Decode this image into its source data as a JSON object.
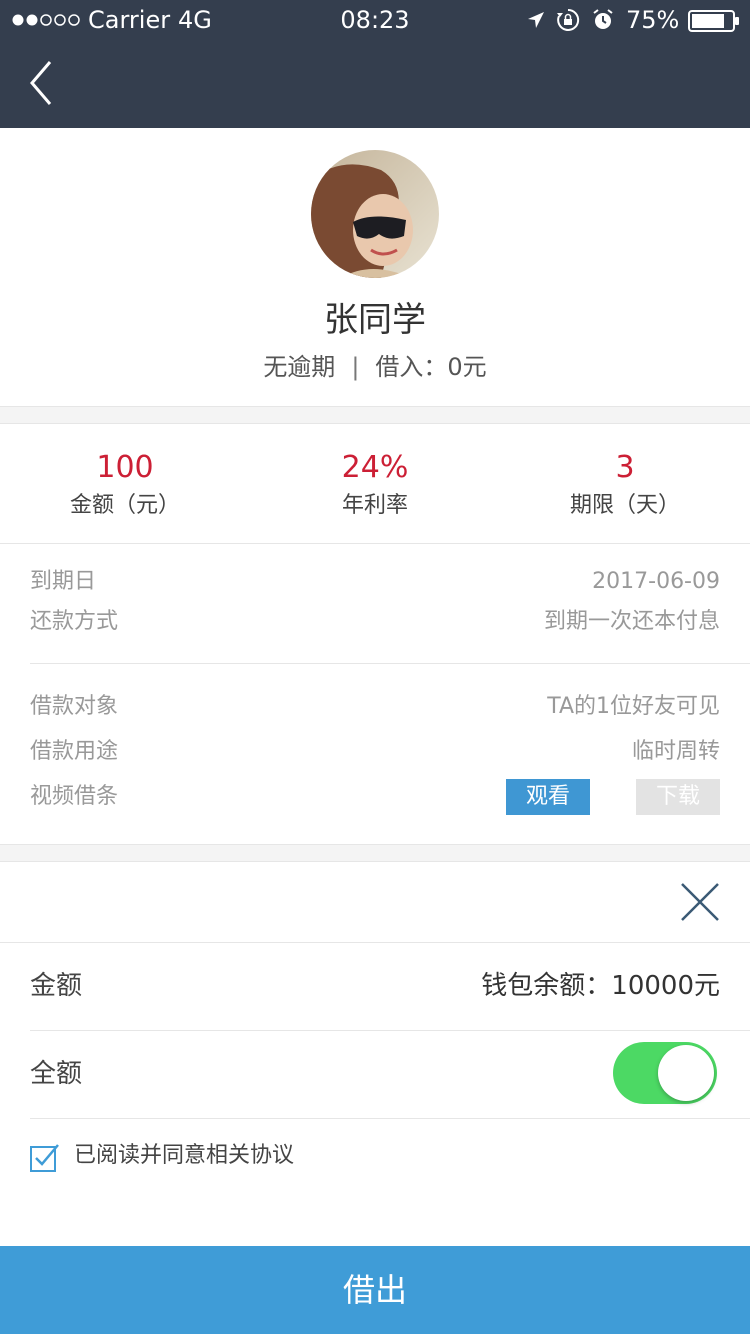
{
  "status_bar": {
    "carrier": "Carrier",
    "network": "4G",
    "time": "08:23",
    "battery": "75%",
    "icons": [
      "location-icon",
      "rotation-lock-icon",
      "alarm-icon",
      "battery-icon"
    ]
  },
  "nav": {
    "back_icon": "chevron-left-icon"
  },
  "profile": {
    "name": "张同学",
    "overdue_status": "无逾期",
    "separator": "|",
    "borrowed": "借入：0元"
  },
  "stats": [
    {
      "value": "100",
      "label": "金额（元）"
    },
    {
      "value": "24%",
      "label": "年利率"
    },
    {
      "value": "3",
      "label": "期限（天）"
    }
  ],
  "details": {
    "due_date": {
      "label": "到期日",
      "value": "2017-06-09"
    },
    "repayment": {
      "label": "还款方式",
      "value": "到期一次还本付息"
    },
    "target": {
      "label": "借款对象",
      "value": "TA的1位好友可见"
    },
    "purpose": {
      "label": "借款用途",
      "value": "临时周转"
    },
    "video_note": {
      "label": "视频借条",
      "watch_label": "观看",
      "download_label": "下载"
    }
  },
  "sheet": {
    "amount_label": "金额",
    "wallet_balance": "钱包余额：10000元",
    "full_amount_label": "全额",
    "full_amount_on": true,
    "agree_checked": true,
    "agree_text": "已阅读并同意相关协议"
  },
  "submit_label": "借出",
  "colors": {
    "header_bg": "#343e4e",
    "accent_red": "#cc1f35",
    "accent_blue": "#3f9cd7",
    "toggle_green": "#4cd964"
  }
}
